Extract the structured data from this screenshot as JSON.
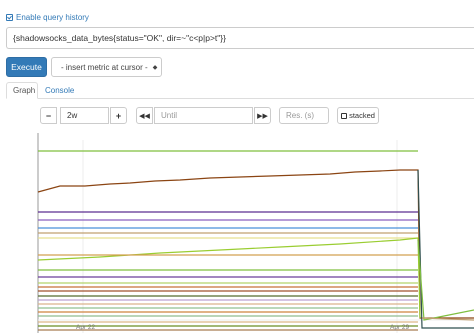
{
  "query_history": {
    "label": "Enable query history",
    "enabled": true
  },
  "expression": {
    "value": "{shadowsocks_data_bytes{status=\"OK\", dir=~\"c<p|p>t\"}}"
  },
  "buttons": {
    "execute": "Execute",
    "insert_metric": "- insert metric at cursor -"
  },
  "tabs": [
    {
      "label": "Graph",
      "active": true
    },
    {
      "label": "Console",
      "active": false
    }
  ],
  "controls": {
    "range_minus": "−",
    "range_value": "2w",
    "range_plus": "+",
    "time_back": "◀◀",
    "until_placeholder": "Until",
    "time_forward": "▶▶",
    "resolution_placeholder": "Res. (s)",
    "stacked_label": "stacked"
  },
  "graph": {
    "x_ticks": [
      "Apr 22",
      "Apr 29"
    ]
  },
  "colors": {
    "accent": "#337ab7"
  }
}
